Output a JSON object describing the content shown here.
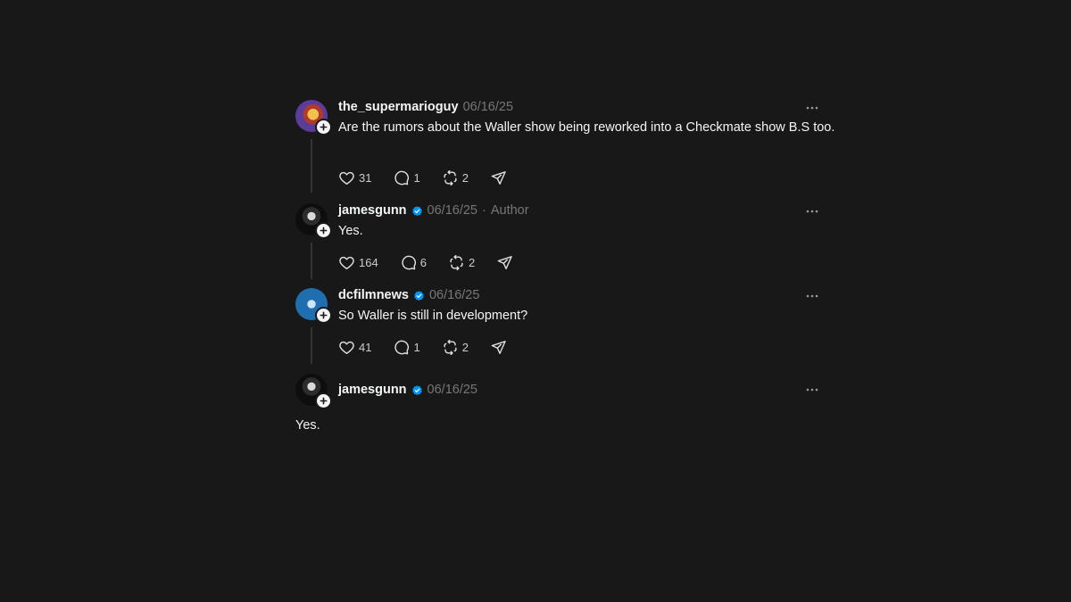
{
  "posts": [
    {
      "username": "the_supermarioguy",
      "date": "06/16/25",
      "author_tag": "",
      "verified": false,
      "text": "Are the rumors about the Waller show being reworked into a Checkmate show B.S too.",
      "likes": "31",
      "replies": "1",
      "reposts": "2"
    },
    {
      "username": "jamesgunn",
      "date": "06/16/25",
      "author_tag": "Author",
      "verified": true,
      "text": "Yes.",
      "likes": "164",
      "replies": "6",
      "reposts": "2"
    },
    {
      "username": "dcfilmnews",
      "date": "06/16/25",
      "author_tag": "",
      "verified": true,
      "text": "So Waller is still in development?",
      "likes": "41",
      "replies": "1",
      "reposts": "2"
    },
    {
      "username": "jamesgunn",
      "date": "06/16/25",
      "author_tag": "",
      "verified": true,
      "text": "Yes."
    }
  ],
  "colors": {
    "background": "#181818",
    "text": "#f3f5f7",
    "muted": "#777777",
    "verified": "#0095f6"
  },
  "icons": [
    "heart-icon",
    "comment-icon",
    "repost-icon",
    "share-icon",
    "more-icon",
    "verified-icon",
    "follow-plus-icon"
  ]
}
